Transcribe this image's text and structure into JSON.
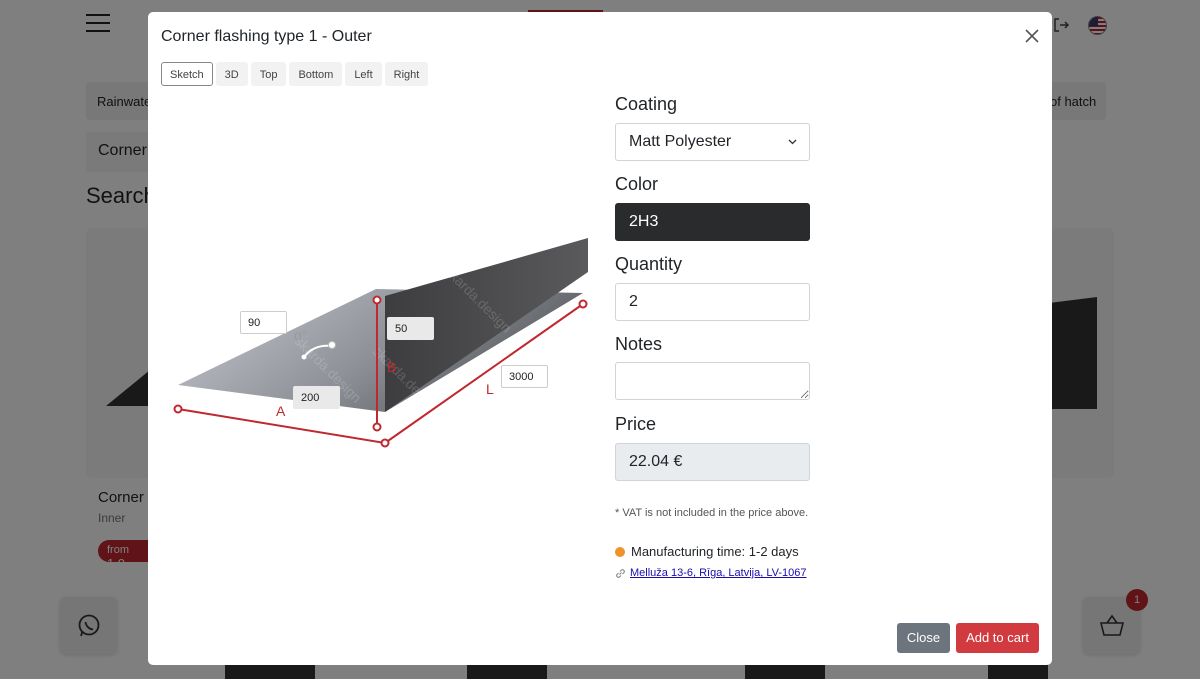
{
  "background": {
    "category_left": "Rainwate",
    "category_right": "of hatch",
    "corner_label": "Corner",
    "search_heading": "Search",
    "card": {
      "name": "Corner",
      "sub": "Inner",
      "price_prefix": "from",
      "price": "1.9"
    },
    "cart_count": "1"
  },
  "modal": {
    "title": "Corner flashing type 1 - Outer",
    "view_tabs": [
      {
        "label": "Sketch",
        "active": true
      },
      {
        "label": "3D",
        "active": false
      },
      {
        "label": "Top",
        "active": false
      },
      {
        "label": "Bottom",
        "active": false
      },
      {
        "label": "Left",
        "active": false
      },
      {
        "label": "Right",
        "active": false
      }
    ],
    "sketch": {
      "angle_value": "90",
      "angle_symbol": "α°",
      "dim_b_value": "50",
      "dim_b_label": "B",
      "dim_a_value": "200",
      "dim_a_label": "A",
      "dim_l_value": "3000",
      "dim_l_label": "L",
      "watermark": "skarda.design"
    },
    "form": {
      "coating_label": "Coating",
      "coating_value": "Matt Polyester",
      "color_label": "Color",
      "color_value": "2H3",
      "color_swatch": "#2a2b2d",
      "quantity_label": "Quantity",
      "quantity_value": "2",
      "notes_label": "Notes",
      "notes_value": "",
      "price_label": "Price",
      "price_value": "22.04 €",
      "vat_note": "* VAT is not included in the price above.",
      "manufacturing": "Manufacturing time: 1-2 days",
      "manufacturing_dot_color": "#f0922b",
      "address": "Melluža 13-6, Rīga, Latvija, LV-1067"
    },
    "buttons": {
      "close": "Close",
      "add_to_cart": "Add to cart"
    }
  },
  "colors": {
    "accent": "#c0282f",
    "dimension_line": "#c0282f",
    "secondary_button": "#6c757d",
    "primary_button": "#d13a3f"
  }
}
